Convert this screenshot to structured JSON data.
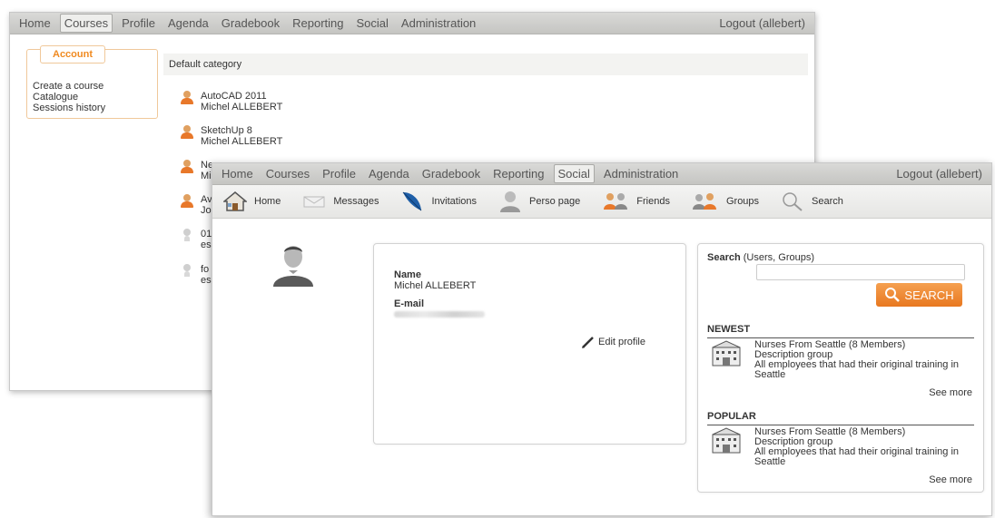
{
  "back_window": {
    "nav": [
      "Home",
      "Courses",
      "Profile",
      "Agenda",
      "Gradebook",
      "Reporting",
      "Social",
      "Administration"
    ],
    "active_nav": "Courses",
    "logout": "Logout (allebert)",
    "account": {
      "title": "Account",
      "links": [
        "Create a course",
        "Catalogue",
        "Sessions history"
      ]
    },
    "category": "Default category",
    "courses": [
      {
        "name": "AutoCAD 2011",
        "teacher": "Michel ALLEBERT",
        "icon": "user-orange"
      },
      {
        "name": "SketchUp 8",
        "teacher": "Michel ALLEBERT",
        "icon": "user-orange"
      },
      {
        "name": "Ne",
        "teacher": "Mi",
        "icon": "user-orange"
      },
      {
        "name": "Av",
        "teacher": "Jo",
        "icon": "user-orange"
      },
      {
        "name": "01",
        "teacher": "es",
        "icon": "user-gray"
      },
      {
        "name": "fo",
        "teacher": "es",
        "icon": "user-gray"
      }
    ]
  },
  "front_window": {
    "nav": [
      "Home",
      "Courses",
      "Profile",
      "Agenda",
      "Gradebook",
      "Reporting",
      "Social",
      "Administration"
    ],
    "active_nav": "Social",
    "logout": "Logout (allebert)",
    "toolbar": [
      {
        "label": "Home",
        "icon": "house-icon"
      },
      {
        "label": "Messages",
        "icon": "envelope-icon"
      },
      {
        "label": "Invitations",
        "icon": "feather-icon"
      },
      {
        "label": "Perso page",
        "icon": "person-icon"
      },
      {
        "label": "Friends",
        "icon": "friends-icon"
      },
      {
        "label": "Groups",
        "icon": "groups-icon"
      },
      {
        "label": "Search",
        "icon": "magnifier-icon"
      }
    ],
    "profile": {
      "name_label": "Name",
      "name_value": "Michel ALLEBERT",
      "email_label": "E-mail",
      "edit_label": "Edit profile"
    },
    "search": {
      "label_bold": "Search",
      "label_rest": " (Users, Groups)",
      "button": "SEARCH"
    },
    "newest": {
      "title": "NEWEST",
      "group_name": "Nurses From Seattle (8 Members)",
      "group_desc": "Description group",
      "group_detail": "All employees that had their original training in Seattle",
      "see_more": "See more"
    },
    "popular": {
      "title": "POPULAR",
      "group_name": "Nurses From Seattle (8 Members)",
      "group_desc": "Description group",
      "group_detail": "All employees that had their original training in Seattle",
      "see_more": "See more"
    }
  },
  "colors": {
    "accent_orange": "#e87820",
    "nav_bg": "#c9c9c6"
  }
}
